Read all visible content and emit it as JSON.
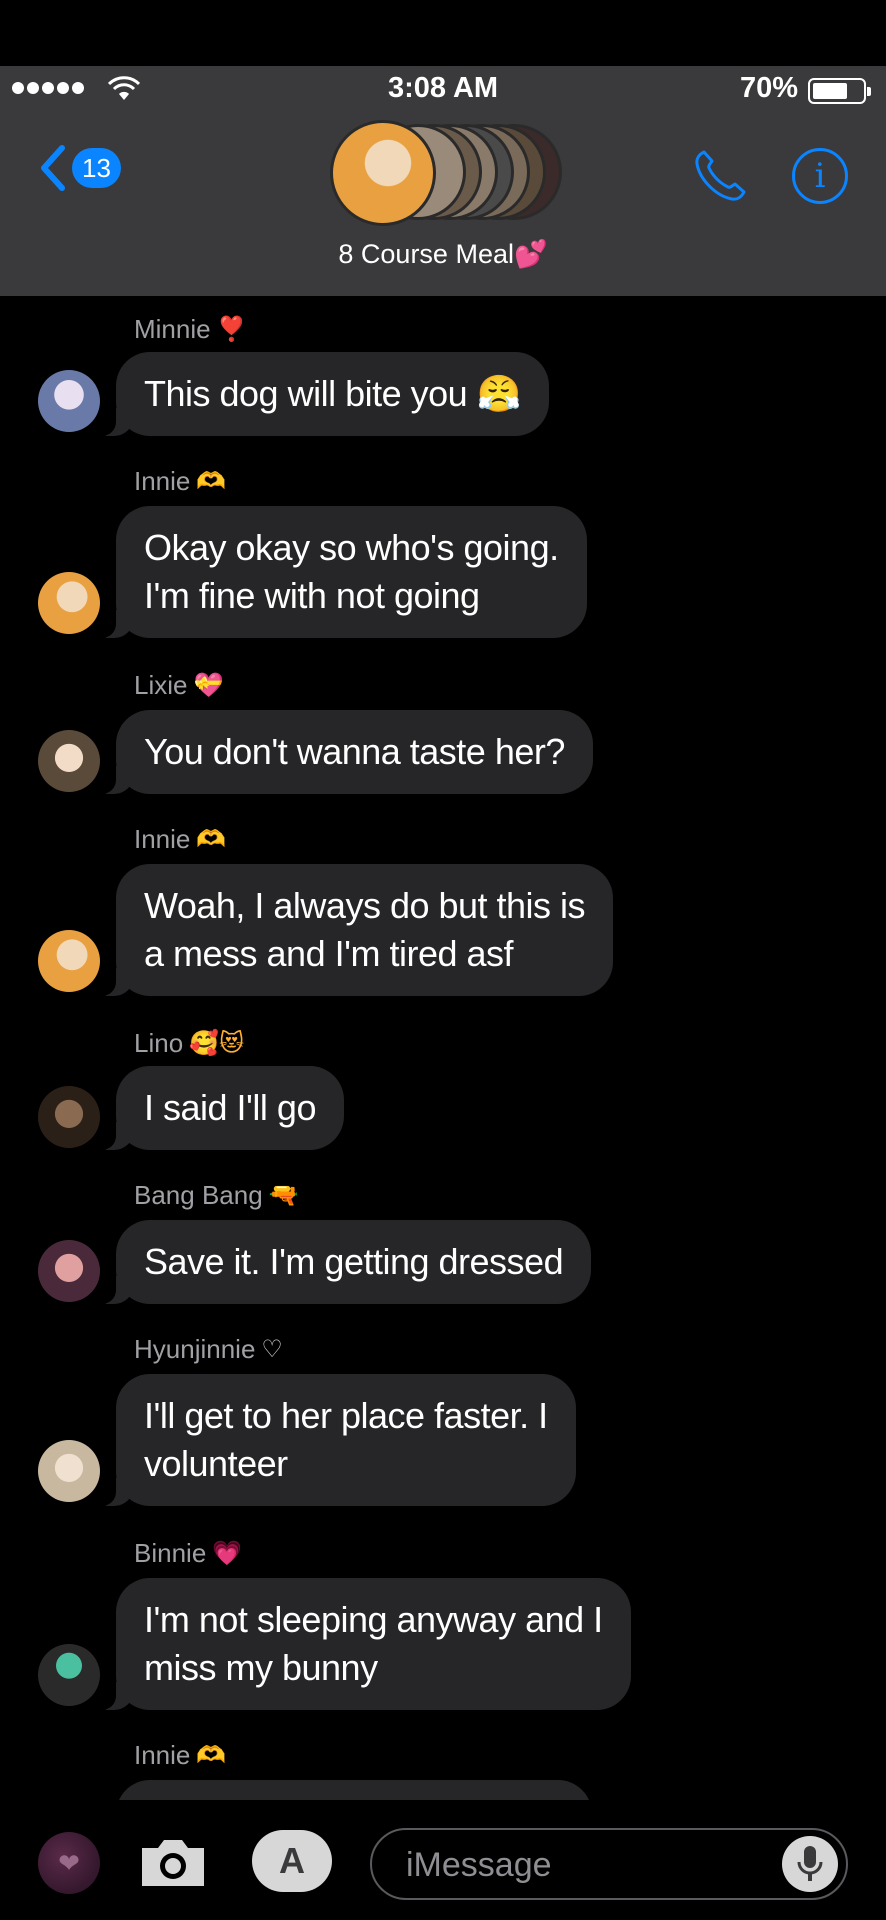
{
  "status_bar": {
    "time": "3:08 AM",
    "battery": "70%"
  },
  "header": {
    "back_count": "13",
    "group_name": "8 Course Meal💕"
  },
  "messages": [
    {
      "sender": "Minnie",
      "sender_emoji": "❣️",
      "text": "This dog will bite you 😤"
    },
    {
      "sender": "Innie",
      "sender_emoji": "🫶",
      "lines": [
        "Okay okay so who's going.",
        "I'm fine with not going"
      ]
    },
    {
      "sender": "Lixie",
      "sender_emoji": "💝",
      "text": "You don't wanna taste her?"
    },
    {
      "sender": "Innie",
      "sender_emoji": "🫶",
      "lines": [
        "Woah, I always do but this is",
        "a mess and I'm tired asf"
      ]
    },
    {
      "sender": "Lino",
      "sender_emoji": "🥰😻",
      "text": "I said I'll go"
    },
    {
      "sender": "Bang Bang",
      "sender_emoji": "🔫",
      "text": "Save it. I'm getting dressed"
    },
    {
      "sender": "Hyunjinnie",
      "sender_emoji": "♡",
      "lines": [
        "I'll get to her place faster. I",
        "volunteer"
      ]
    },
    {
      "sender": "Binnie",
      "sender_emoji": "💗",
      "lines": [
        "I'm not sleeping anyway and I",
        "miss my bunny"
      ]
    },
    {
      "sender": "Innie",
      "sender_emoji": "🫶"
    }
  ],
  "composer": {
    "placeholder": "iMessage"
  },
  "colors": {
    "accent": "#0a84ff",
    "bubble": "#262628",
    "header": "#3a3a3c"
  }
}
